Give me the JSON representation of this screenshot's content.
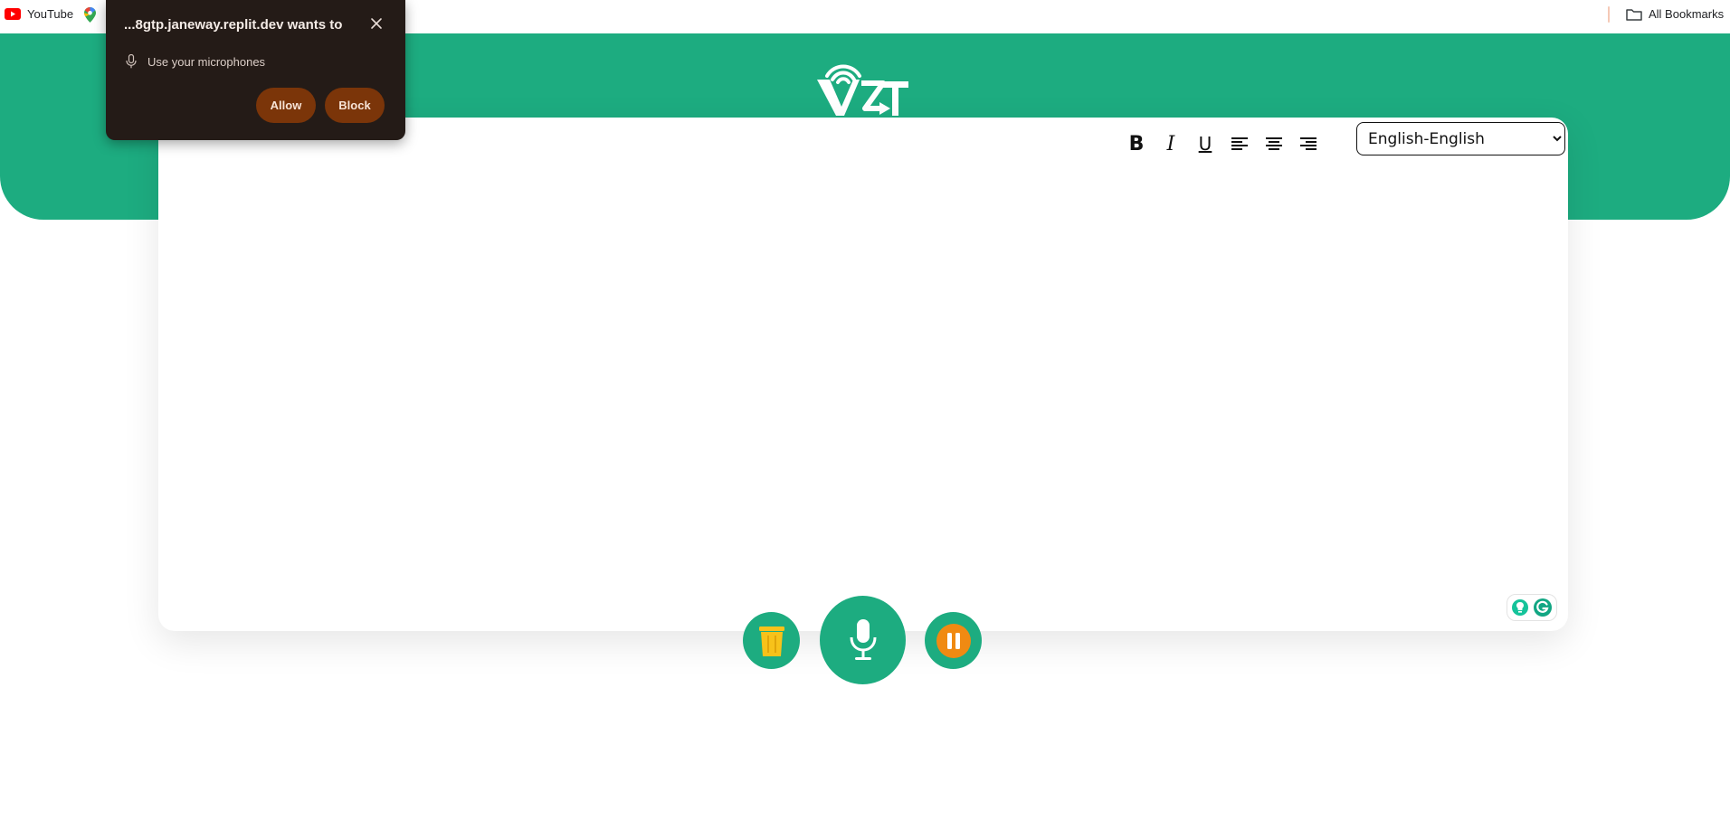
{
  "bookmarks": {
    "youtube_label": "YouTube",
    "all_bookmarks_label": "All Bookmarks"
  },
  "permission_prompt": {
    "title": "...8gtp.janeway.replit.dev wants to",
    "permission": "Use your microphones",
    "allow_label": "Allow",
    "block_label": "Block"
  },
  "editor": {
    "toolbar": {
      "bold": "B",
      "italic": "I",
      "underline": "U"
    },
    "language": {
      "selected": "English-English",
      "options": [
        "English-English"
      ]
    },
    "content": ""
  },
  "colors": {
    "brand_green": "#1dac80",
    "popup_bg": "#241b17",
    "popup_button": "#7b3509",
    "trash_yellow": "#f7c21a",
    "pause_orange": "#f08a12"
  },
  "icons": {
    "trash": "trash-icon",
    "mic": "microphone-icon",
    "pause": "pause-icon"
  }
}
